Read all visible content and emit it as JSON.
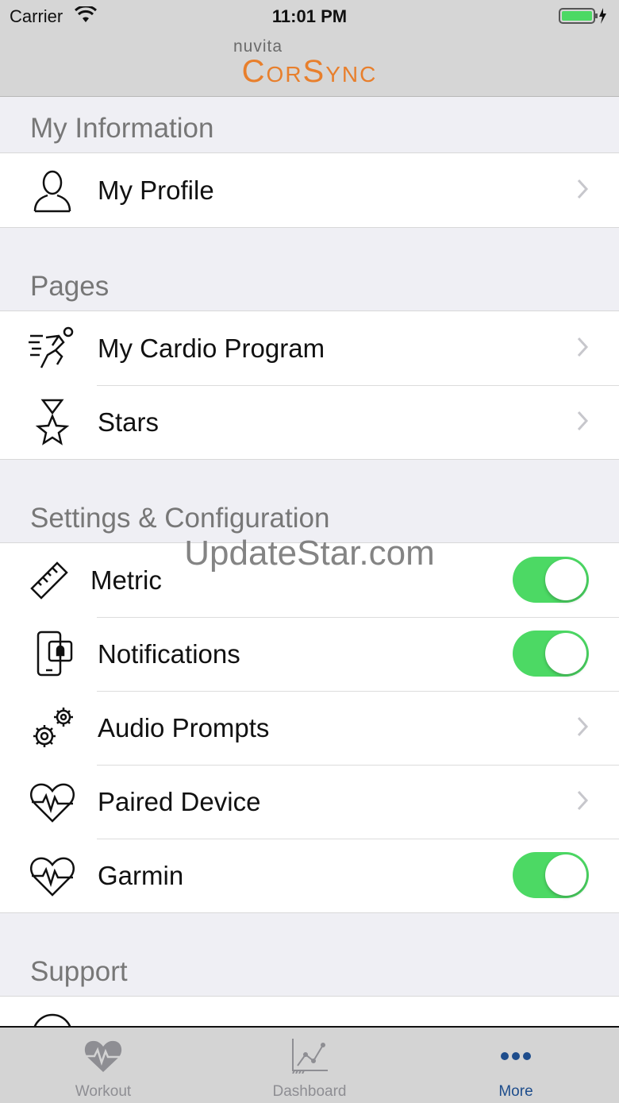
{
  "status_bar": {
    "carrier": "Carrier",
    "time": "11:01 PM",
    "battery_color": "#4cd964"
  },
  "header": {
    "brand_small": "nuvita",
    "brand_big": "CorSync",
    "brand_color": "#e87f2c"
  },
  "sections": {
    "my_information": {
      "title": "My Information",
      "items": [
        {
          "label": "My Profile",
          "icon": "person-icon",
          "accessory": "chevron"
        }
      ]
    },
    "pages": {
      "title": "Pages",
      "items": [
        {
          "label": "My Cardio Program",
          "icon": "runner-icon",
          "accessory": "chevron"
        },
        {
          "label": "Stars",
          "icon": "star-medal-icon",
          "accessory": "chevron"
        }
      ]
    },
    "settings": {
      "title": "Settings & Configuration",
      "items": [
        {
          "label": "Metric",
          "icon": "ruler-icon",
          "accessory": "toggle",
          "on": true
        },
        {
          "label": "Notifications",
          "icon": "phone-notification-icon",
          "accessory": "toggle",
          "on": true
        },
        {
          "label": "Audio Prompts",
          "icon": "gears-icon",
          "accessory": "chevron"
        },
        {
          "label": "Paired Device",
          "icon": "heart-pulse-icon",
          "accessory": "chevron"
        },
        {
          "label": "Garmin",
          "icon": "heart-pulse-icon",
          "accessory": "toggle",
          "on": true
        }
      ]
    },
    "support": {
      "title": "Support"
    }
  },
  "watermark": "UpdateStar.com",
  "tab_bar": {
    "tabs": [
      {
        "label": "Workout",
        "icon": "heart-pulse-icon",
        "active": false
      },
      {
        "label": "Dashboard",
        "icon": "line-chart-icon",
        "active": false
      },
      {
        "label": "More",
        "icon": "ellipsis-icon",
        "active": true
      }
    ],
    "active_color": "#1e4d8c",
    "toggle_color": "#4cd964"
  }
}
